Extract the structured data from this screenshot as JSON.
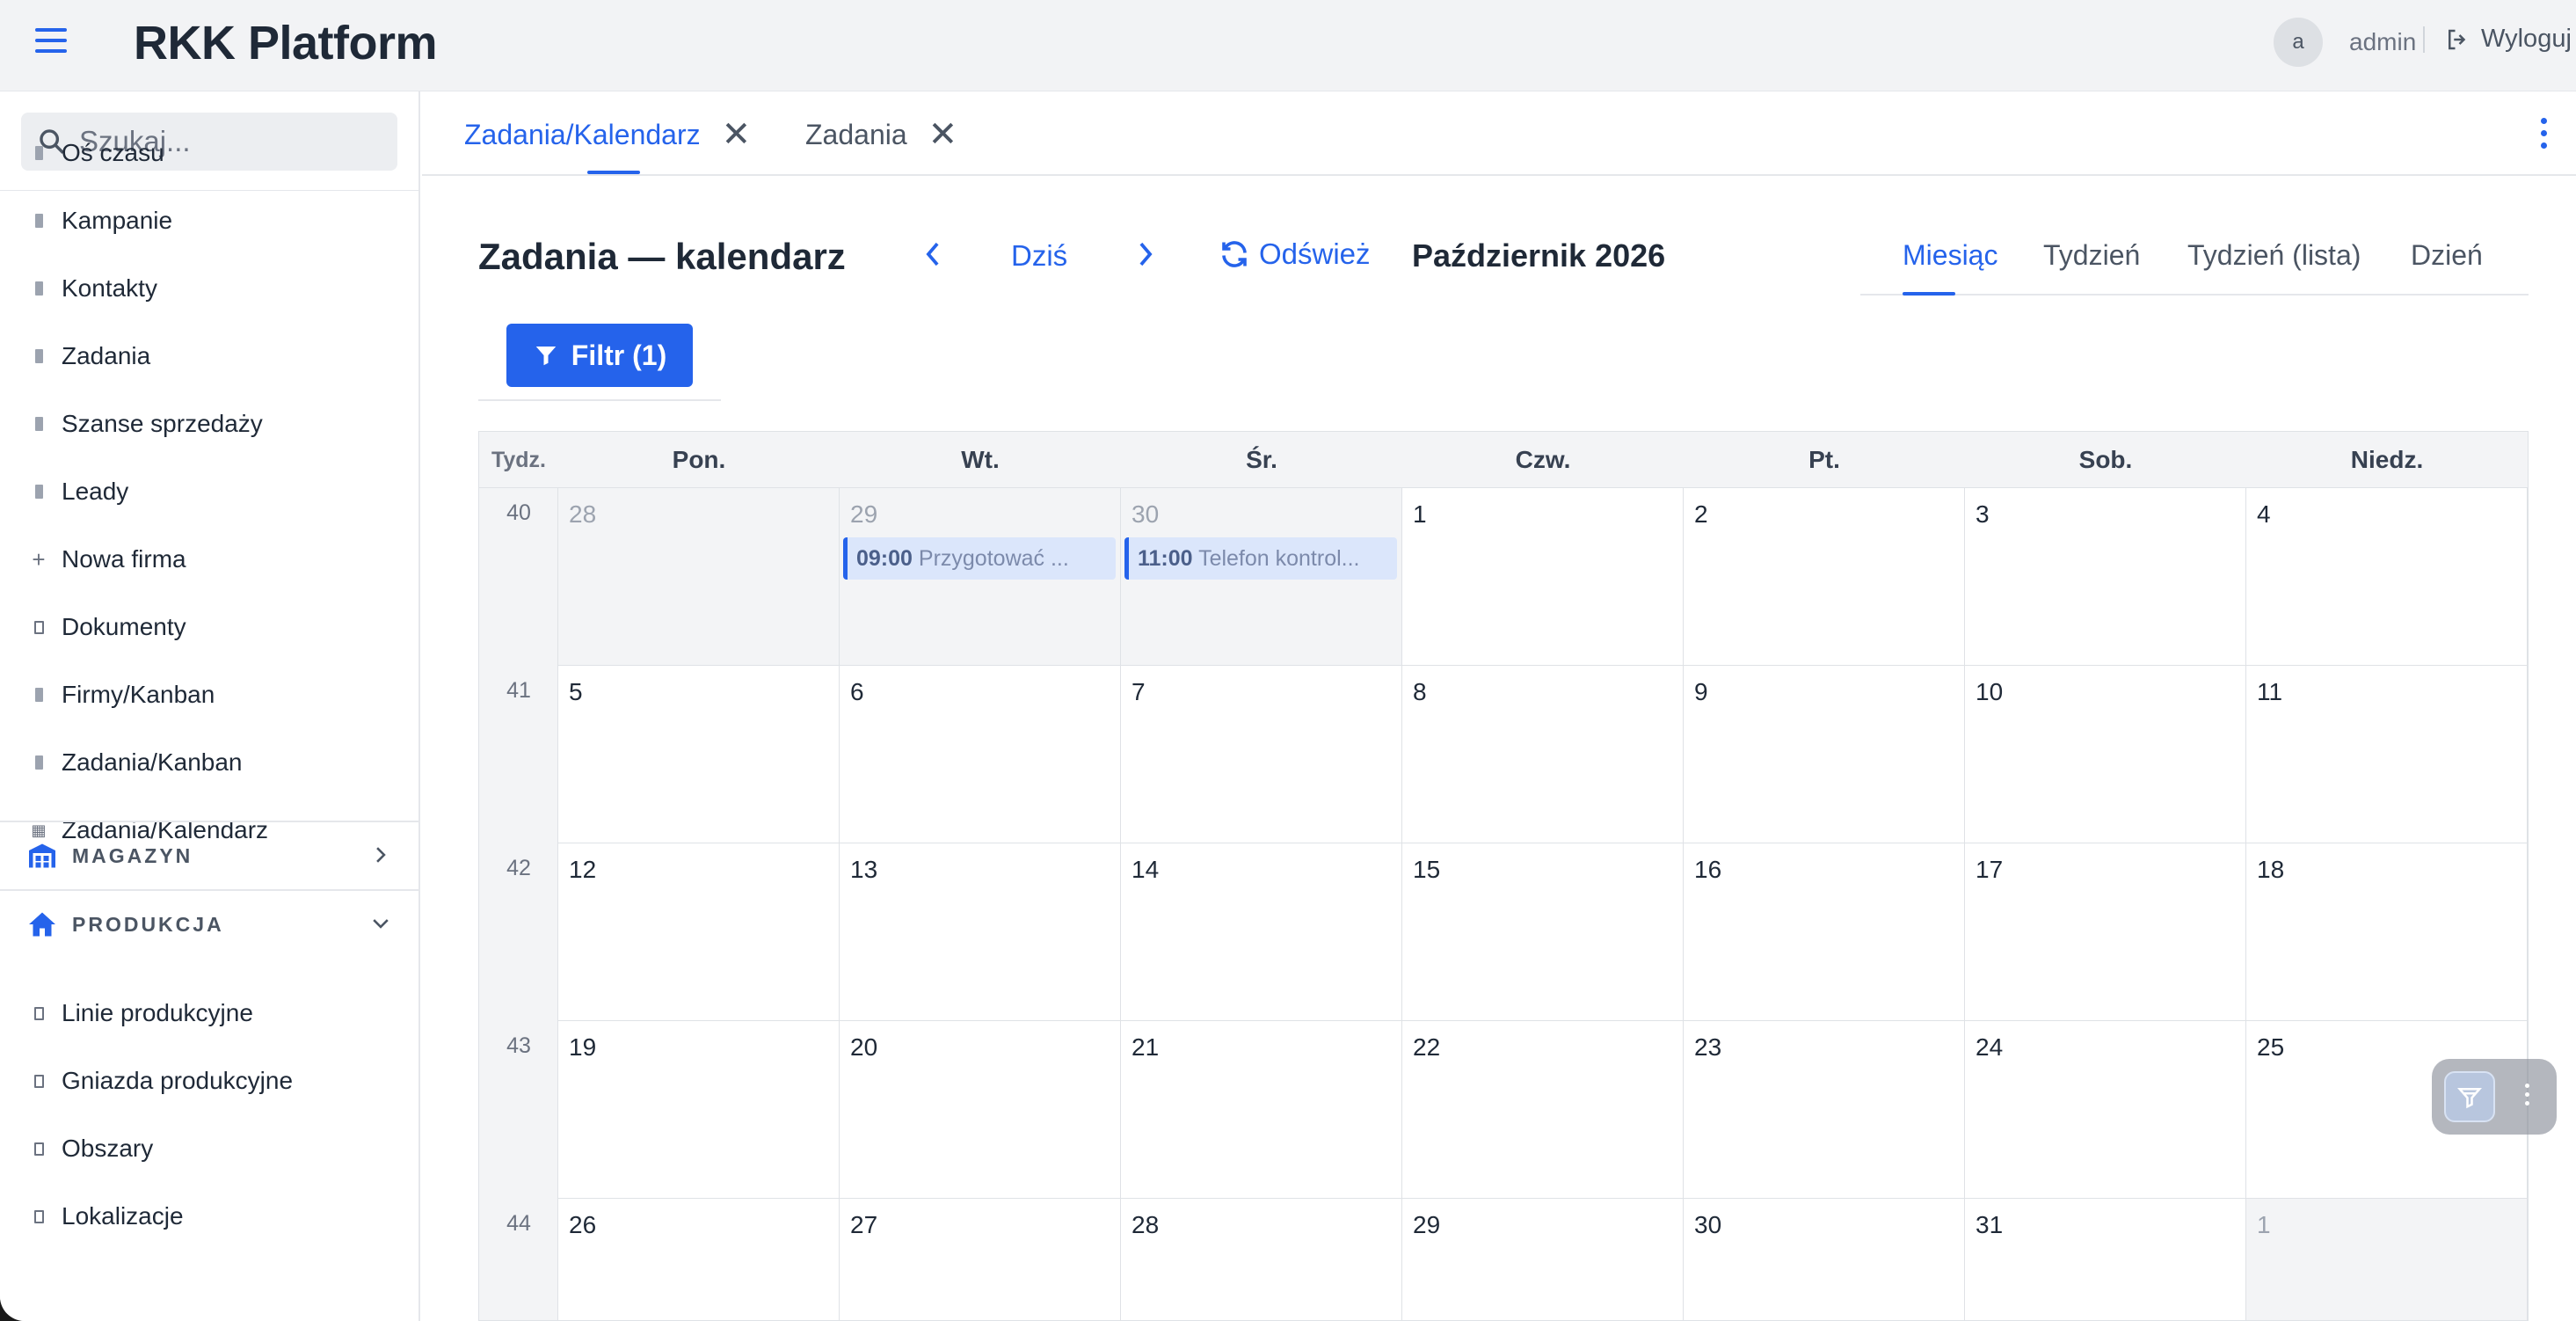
{
  "app": {
    "title": "RKK Platform"
  },
  "user": {
    "avatar_initial": "a",
    "name": "admin",
    "logout_label": "Wyloguj"
  },
  "search": {
    "placeholder": "Szukaj..."
  },
  "sidebar": {
    "items": [
      {
        "label": "Oś czasu",
        "icon": "building-icon"
      },
      {
        "label": "Kampanie",
        "icon": "building-icon"
      },
      {
        "label": "Kontakty",
        "icon": "building-icon"
      },
      {
        "label": "Zadania",
        "icon": "building-icon"
      },
      {
        "label": "Szanse sprzedaży",
        "icon": "building-icon"
      },
      {
        "label": "Leady",
        "icon": "building-icon"
      },
      {
        "label": "Nowa firma",
        "icon": "plus-icon"
      },
      {
        "label": "Dokumenty",
        "icon": "document-icon"
      },
      {
        "label": "Firmy/Kanban",
        "icon": "building-icon"
      },
      {
        "label": "Zadania/Kanban",
        "icon": "building-icon"
      },
      {
        "label": "Zadania/Kalendarz",
        "icon": "calendar-icon"
      }
    ],
    "sections": [
      {
        "label": "MAGAZYN",
        "icon": "warehouse-icon",
        "expanded": false
      },
      {
        "label": "PRODUKCJA",
        "icon": "home-icon",
        "expanded": true
      }
    ],
    "production_items": [
      {
        "label": "Linie produkcyjne",
        "icon": "document-icon"
      },
      {
        "label": "Gniazda produkcyjne",
        "icon": "document-icon"
      },
      {
        "label": "Obszary",
        "icon": "document-icon"
      },
      {
        "label": "Lokalizacje",
        "icon": "document-icon"
      }
    ]
  },
  "tabs": [
    {
      "label": "Zadania/Kalendarz",
      "active": true
    },
    {
      "label": "Zadania",
      "active": false
    }
  ],
  "calendar": {
    "title": "Zadania — kalendarz",
    "today_label": "Dziś",
    "refresh_label": "Odśwież",
    "period": "Październik 2026",
    "views": [
      "Miesiąc",
      "Tydzień",
      "Tydzień (lista)",
      "Dzień"
    ],
    "active_view": "Miesiąc",
    "filter_label": "Filtr (1)",
    "week_header": "Tydz.",
    "weekdays": [
      "Pon.",
      "Wt.",
      "Śr.",
      "Czw.",
      "Pt.",
      "Sob.",
      "Niedz."
    ],
    "weeks": [
      {
        "num": "40",
        "days": [
          "28",
          "29",
          "30",
          "1",
          "2",
          "3",
          "4"
        ],
        "other": [
          true,
          true,
          true,
          false,
          false,
          false,
          false
        ]
      },
      {
        "num": "41",
        "days": [
          "5",
          "6",
          "7",
          "8",
          "9",
          "10",
          "11"
        ],
        "other": [
          false,
          false,
          false,
          false,
          false,
          false,
          false
        ]
      },
      {
        "num": "42",
        "days": [
          "12",
          "13",
          "14",
          "15",
          "16",
          "17",
          "18"
        ],
        "other": [
          false,
          false,
          false,
          false,
          false,
          false,
          false
        ]
      },
      {
        "num": "43",
        "days": [
          "19",
          "20",
          "21",
          "22",
          "23",
          "24",
          "25"
        ],
        "other": [
          false,
          false,
          false,
          false,
          false,
          false,
          false
        ]
      },
      {
        "num": "44",
        "days": [
          "26",
          "27",
          "28",
          "29",
          "30",
          "31",
          "1"
        ],
        "other": [
          false,
          false,
          false,
          false,
          false,
          false,
          true
        ]
      }
    ],
    "events": [
      {
        "week": 0,
        "day": 1,
        "time": "09:00",
        "title": "Przygotować ..."
      },
      {
        "week": 0,
        "day": 2,
        "time": "11:00",
        "title": "Telefon kontrol..."
      }
    ]
  },
  "colors": {
    "accent": "#2563eb",
    "event_bg": "#dbe6fb",
    "other_month_bg": "#f3f4f6"
  }
}
